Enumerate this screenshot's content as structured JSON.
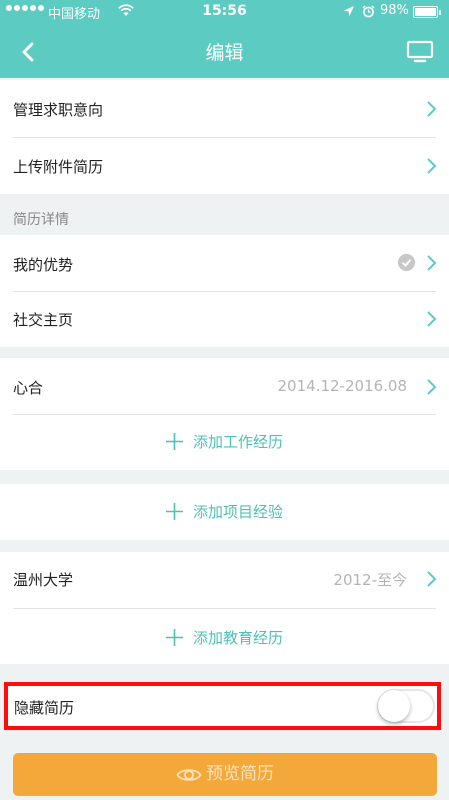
{
  "status_bar": {
    "carrier": "中国移动",
    "time": "15:56",
    "battery": "98%",
    "battery_level": 0.98
  },
  "nav": {
    "title": "编辑",
    "back_icon": "chevron-left-icon",
    "screen_icon": "monitor-icon"
  },
  "top_items": [
    {
      "label": "管理求职意向"
    },
    {
      "label": "上传附件简历"
    }
  ],
  "details_section": {
    "title": "简历详情",
    "items": [
      {
        "label": "我的优势",
        "completed": true
      },
      {
        "label": "社交主页"
      }
    ]
  },
  "work": {
    "entry": {
      "label": "心合",
      "value": "2014.12-2016.08"
    },
    "add_label": "添加工作经历"
  },
  "project": {
    "add_label": "添加项目经验"
  },
  "education": {
    "entry": {
      "label": "温州大学",
      "value": "2012-至今"
    },
    "add_label": "添加教育经历"
  },
  "hide_resume": {
    "label": "隐藏简历",
    "enabled": false
  },
  "preview_button": {
    "label": "预览简历",
    "icon": "eye-icon"
  },
  "colors": {
    "accent": "#5ccbc1",
    "add_text": "#4fc0b6",
    "preview": "#f5a83a",
    "highlight": "#ff0d0d"
  }
}
